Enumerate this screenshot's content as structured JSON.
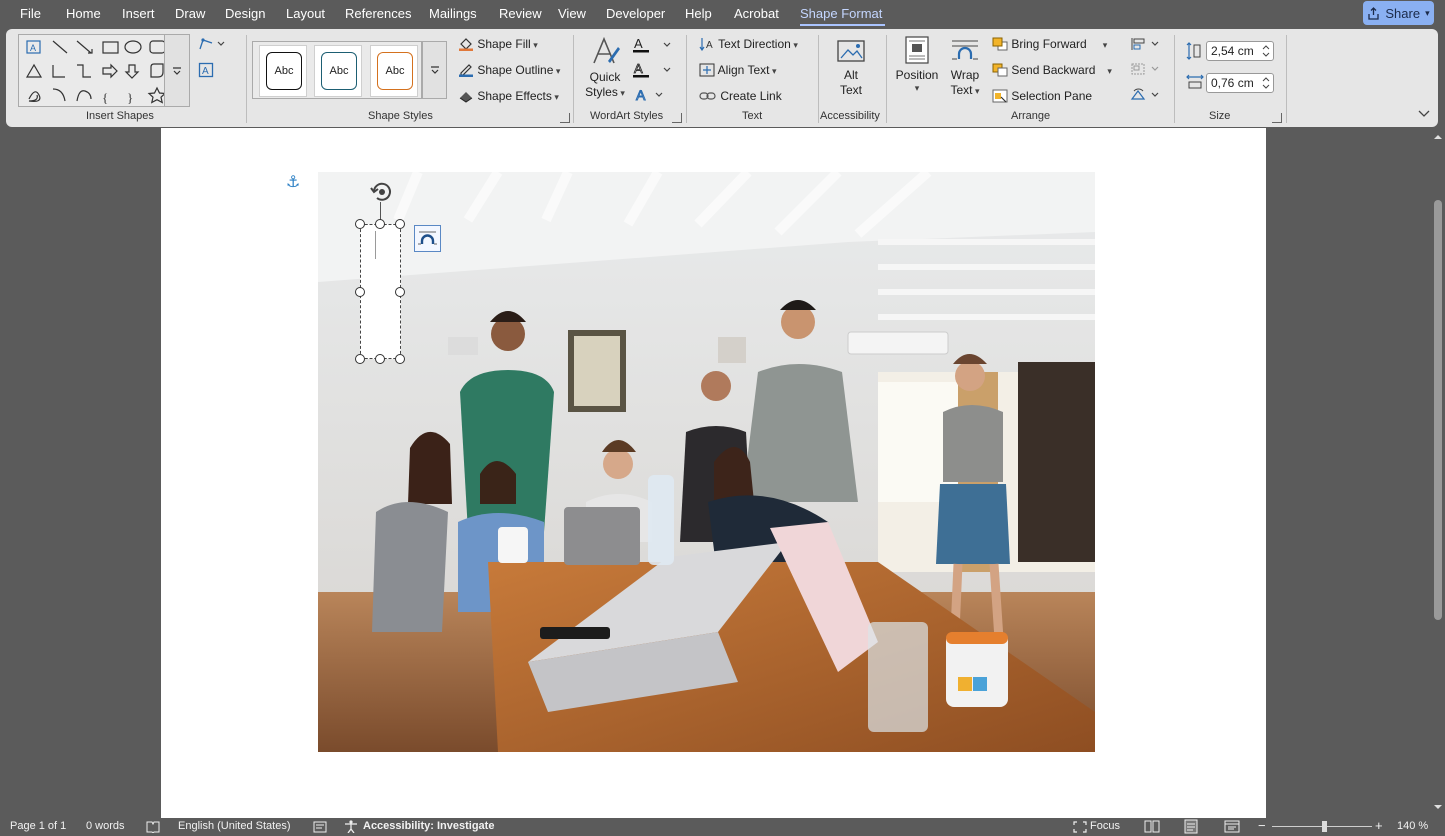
{
  "menu": {
    "tabs": [
      "File",
      "Home",
      "Insert",
      "Draw",
      "Design",
      "Layout",
      "References",
      "Mailings",
      "Review",
      "View",
      "Developer",
      "Help",
      "Acrobat",
      "Shape Format"
    ],
    "active": "Shape Format",
    "share_label": "Share"
  },
  "ribbon": {
    "groups": {
      "insert_shapes": "Insert Shapes",
      "shape_styles": "Shape Styles",
      "wordart_styles": "WordArt Styles",
      "text": "Text",
      "accessibility": "Accessibility",
      "arrange": "Arrange",
      "size": "Size"
    },
    "style_swatches": [
      "Abc",
      "Abc",
      "Abc"
    ],
    "swatch_colors": [
      "#111111",
      "#1d5f73",
      "#d4711e"
    ],
    "shape_fill": "Shape Fill",
    "shape_outline": "Shape Outline",
    "shape_effects": "Shape Effects",
    "quick_styles": [
      "Quick",
      "Styles"
    ],
    "text_direction": "Text Direction",
    "align_text": "Align Text",
    "create_link": "Create Link",
    "alt_text": [
      "Alt",
      "Text"
    ],
    "position": "Position",
    "wrap_text": [
      "Wrap",
      "Text"
    ],
    "bring_forward": "Bring Forward",
    "send_backward": "Send Backward",
    "selection_pane": "Selection Pane",
    "height": "2,54 cm",
    "width": "0,76 cm"
  },
  "status": {
    "page": "Page 1 of 1",
    "words": "0 words",
    "language": "English (United States)",
    "accessibility": "Accessibility: Investigate",
    "focus": "Focus",
    "zoom": "140 %"
  },
  "colors": {
    "accent": "#aac4ff",
    "share_bg": "#8ab0f2",
    "chrome": "#5b5b5b",
    "ribbon": "#e6e6e6"
  }
}
